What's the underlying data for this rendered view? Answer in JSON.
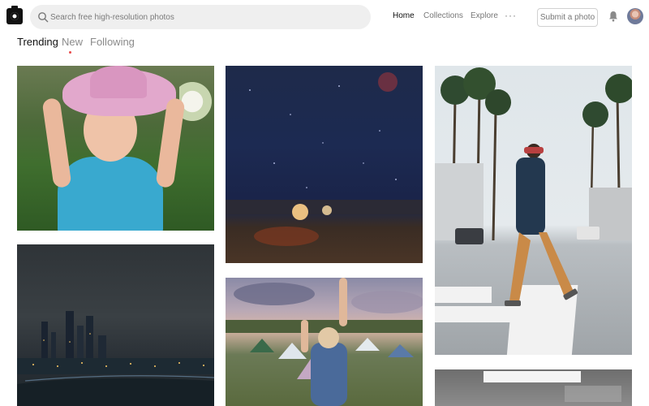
{
  "header": {
    "logo_icon": "camera-logo-icon",
    "search": {
      "icon": "search-icon",
      "placeholder": "Search free high-resolution photos",
      "value": ""
    },
    "nav": [
      {
        "label": "Home",
        "active": true
      },
      {
        "label": "Collections",
        "active": false
      },
      {
        "label": "Explore",
        "active": false
      }
    ],
    "more_icon": "more-dots-icon",
    "more_glyph": "···",
    "submit_label": "Submit a photo",
    "bell_icon": "bell-icon",
    "avatar_icon": "user-avatar"
  },
  "feed_tabs": [
    {
      "label": "Trending",
      "active": true
    },
    {
      "label": "New",
      "active": false,
      "indicator_color": "#e84a4a"
    },
    {
      "label": "Following",
      "active": false
    }
  ],
  "photos": [
    {
      "subject": "girl-in-pink-hat"
    },
    {
      "subject": "night-camp-under-stars"
    },
    {
      "subject": "man-crossing-palm-street"
    },
    {
      "subject": "city-skyline-at-night"
    },
    {
      "subject": "festival-tents-crowd"
    },
    {
      "subject": "graffiti-wall"
    }
  ],
  "colors": {
    "accent_dot": "#e84a4a",
    "search_bg": "#efefef",
    "nav_active": "#111111",
    "nav_inactive": "#777777"
  }
}
